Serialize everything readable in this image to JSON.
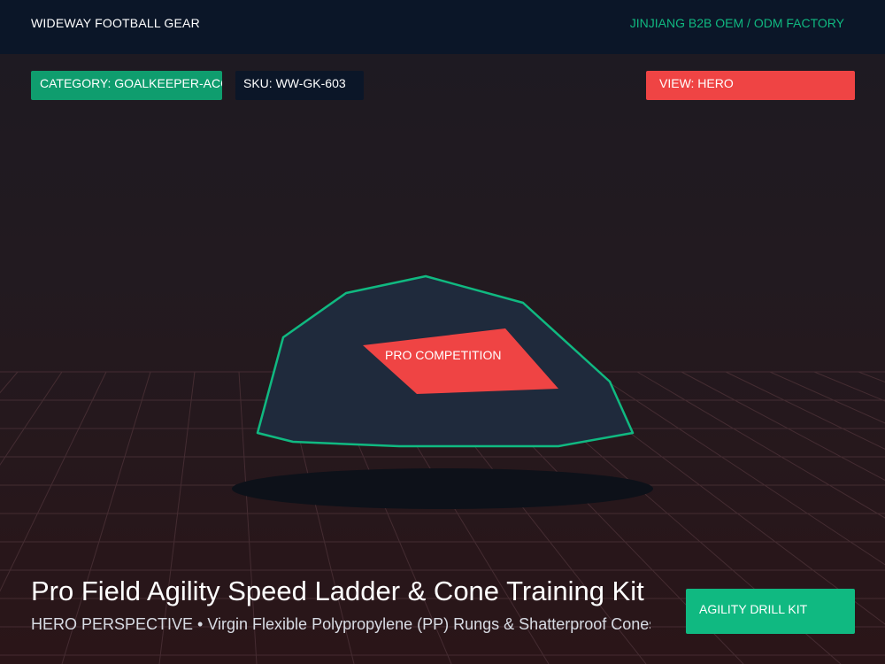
{
  "header": {
    "brand": "WIDEWAY FOOTBALL GEAR",
    "factory": "JINJIANG B2B OEM / ODM FACTORY"
  },
  "tags": {
    "category": "CATEGORY: GOALKEEPER-ACCESSORIES",
    "sku": "SKU: WW-GK-603",
    "view": "VIEW: HERO"
  },
  "product": {
    "badge": "PRO COMPETITION",
    "title": "Pro Field Agility Speed Ladder & Cone Training Kit",
    "subtitle": "HERO PERSPECTIVE • Virgin Flexible Polypropylene (PP) Rungs & Shatterproof Cones",
    "kit_label": "AGILITY DRILL KIT"
  },
  "colors": {
    "header_bg": "#0b1628",
    "accent_green": "#10b981",
    "accent_red": "#ef4444",
    "product_fill": "#1f2a3c"
  }
}
